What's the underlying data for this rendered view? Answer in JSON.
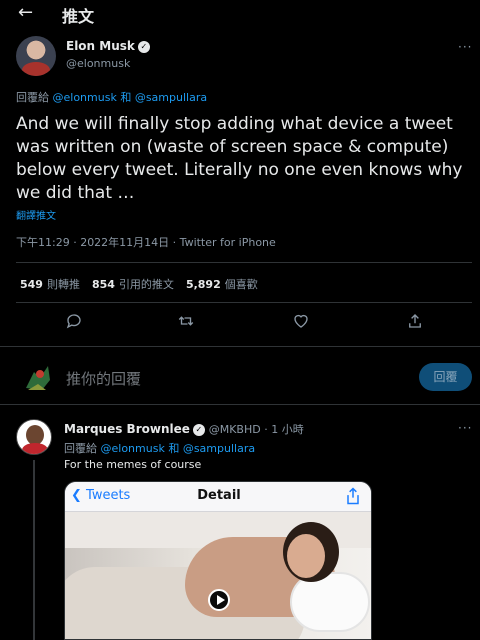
{
  "header": {
    "back_icon": "arrow-left-icon",
    "title": "推文"
  },
  "tweet": {
    "author_name": "Elon Musk",
    "author_handle": "@elonmusk",
    "replying_prefix": "回覆給",
    "replying_to_1": "@elonmusk",
    "replying_and": "和",
    "replying_to_2": "@sampullara",
    "text": "And we will finally stop adding what device a tweet was written on (waste of screen space & compute) below every tweet. Literally no one even knows why we did that …",
    "translate_label": "翻譯推文",
    "timestamp": "下午11:29 · 2022年11月14日 · ",
    "source": "Twitter for iPhone",
    "stats": {
      "retweets_count": "549",
      "retweets_label": "則轉推",
      "quotes_count": "854",
      "quotes_label": "引用的推文",
      "likes_count": "5,892",
      "likes_label": "個喜歡"
    },
    "actions": [
      "reply-icon",
      "retweet-icon",
      "like-icon",
      "share-icon"
    ]
  },
  "compose": {
    "placeholder": "推你的回覆",
    "button_label": "回覆"
  },
  "reply": {
    "author_name": "Marques Brownlee",
    "author_handle": "@MKBHD",
    "time": " · 1 小時",
    "replying_prefix": "回覆給",
    "replying_to_1": "@elonmusk",
    "replying_and": "和",
    "replying_to_2": "@sampullara",
    "text": "For the memes of course",
    "media": {
      "nav_back_label": "Tweets",
      "nav_title": "Detail"
    }
  },
  "colors": {
    "accent": "#1d9bf0",
    "background": "#000000",
    "text": "#e7e9ea",
    "muted": "#8b98a5"
  }
}
